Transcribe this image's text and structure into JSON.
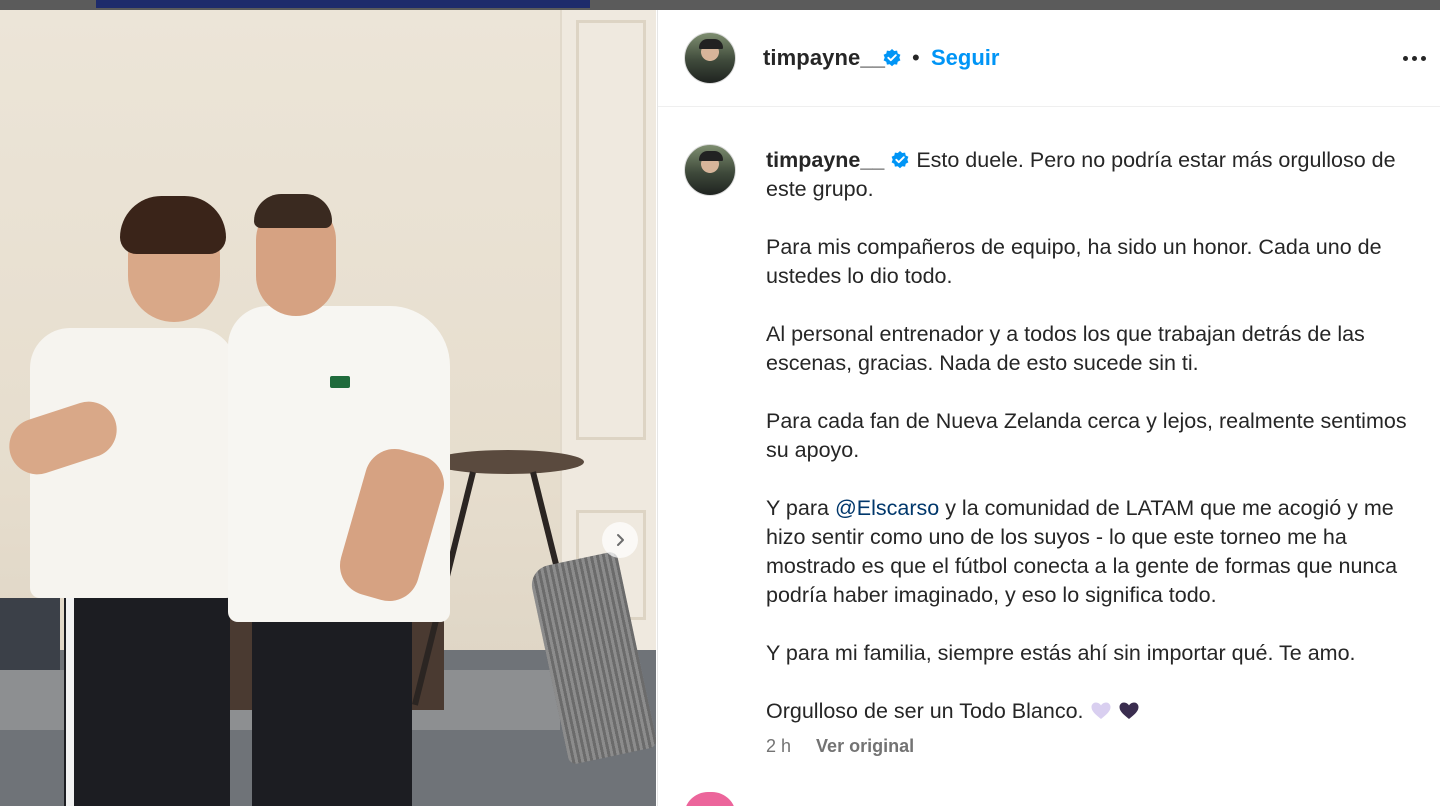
{
  "post": {
    "photo_alt": "",
    "carousel_next_icon": "chevron-right-icon"
  },
  "header": {
    "username": "timpayne__",
    "separator": "•",
    "follow_label": "Seguir",
    "more_icon": "more-options-icon"
  },
  "caption": {
    "username": "timpayne__",
    "paragraphs": [
      "Esto duele. Pero no podría estar más orgulloso de este grupo.",
      "Para mis compañeros de equipo, ha sido un honor. Cada uno de ustedes lo dio todo.",
      "Al personal entrenador y a todos los que trabajan detrás de las escenas, gracias. Nada de esto sucede sin ti.",
      "Para cada fan de Nueva Zelanda cerca y lejos, realmente sentimos su apoyo."
    ],
    "p5_before": "Y para ",
    "p5_mention": "@Elscarso",
    "p5_after": " y la comunidad de LATAM que me acogió y me hizo sentir como uno de los suyos - lo que este torneo me ha mostrado es que el fútbol conecta a la gente de formas que nunca podría haber imaginado, y eso lo significa todo.",
    "p6": "Y para mi familia, siempre estás ahí sin importar qué. Te amo.",
    "p7": "Orgulloso de ser un Todo Blanco.",
    "heart_colors": [
      "#d9cff0",
      "#3a2d4f"
    ]
  },
  "meta": {
    "time": "2 h",
    "translate_label": "Ver original"
  },
  "colors": {
    "link": "#0095f6",
    "mention": "#00376b",
    "verified": "#0095f6"
  }
}
